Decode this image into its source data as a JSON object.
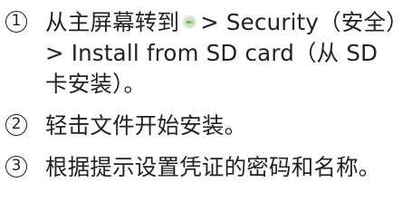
{
  "steps": [
    {
      "number": "1",
      "before_icon": "从主屏幕转到",
      "icon": "settings-icon",
      "after_icon": "> Security（安全）> Install from SD card（从 SD 卡安装）。"
    },
    {
      "number": "2",
      "text": "轻击文件开始安装。"
    },
    {
      "number": "3",
      "text": "根据提示设置凭证的密码和名称。"
    }
  ]
}
